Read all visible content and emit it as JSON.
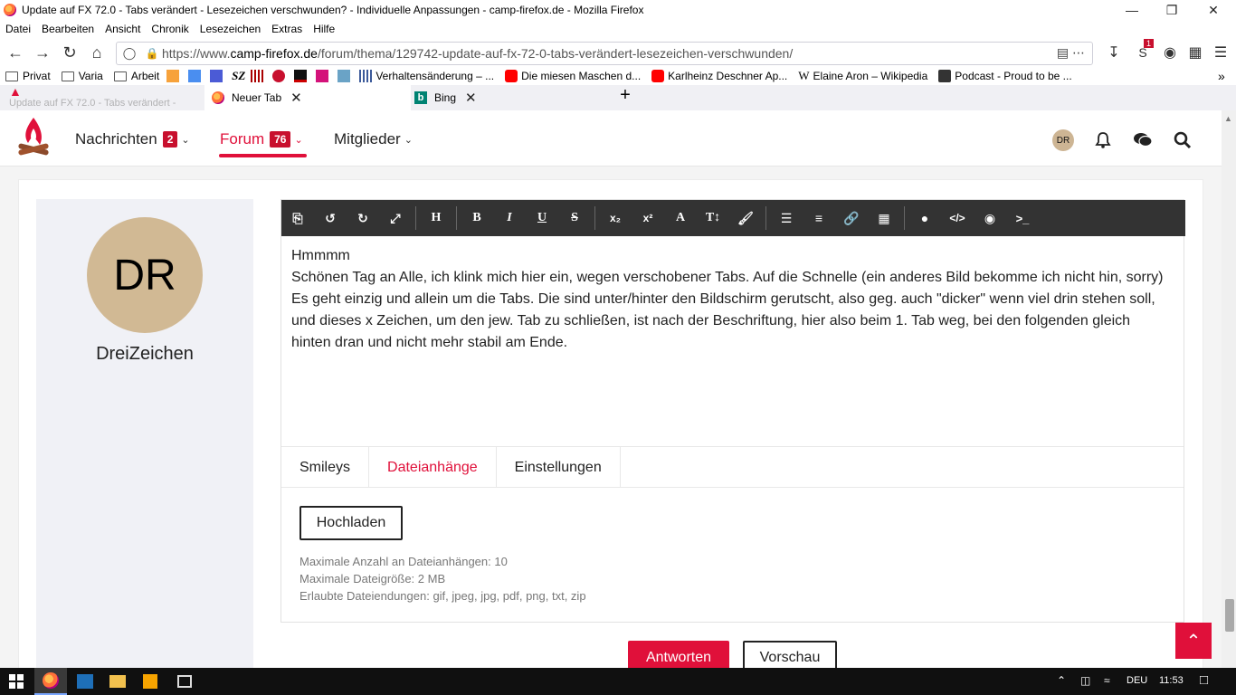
{
  "window": {
    "title": "Update auf FX 72.0 - Tabs verändert - Lesezeichen verschwunden? - Individuelle Anpassungen - camp-firefox.de - Mozilla Firefox"
  },
  "menubar": [
    "Datei",
    "Bearbeiten",
    "Ansicht",
    "Chronik",
    "Lesezeichen",
    "Extras",
    "Hilfe"
  ],
  "urlbar": {
    "prefix": "https://www.",
    "domain": "camp-firefox.de",
    "path": "/forum/thema/129742-update-auf-fx-72-0-tabs-verändert-lesezeichen-verschwunden/"
  },
  "notification_count": "1",
  "bookmarks": {
    "folders": [
      "Privat",
      "Varia",
      "Arbeit"
    ],
    "sz": "SZ",
    "items": [
      "Verhaltensänderung – ...",
      "Die miesen Maschen d...",
      "Karlheinz Deschner Ap...",
      "Elaine Aron – Wikipedia",
      "Podcast - Proud to be ..."
    ],
    "w_glyph": "W"
  },
  "tabs": [
    {
      "label": "Update auf FX 72.0 - Tabs verändert -"
    },
    {
      "label": "Neuer Tab"
    },
    {
      "label": "Bing"
    }
  ],
  "site": {
    "nav": [
      {
        "label": "Nachrichten",
        "badge": "2"
      },
      {
        "label": "Forum",
        "badge": "76"
      },
      {
        "label": "Mitglieder"
      }
    ],
    "header_avatar": "DR"
  },
  "user": {
    "initials": "DR",
    "name": "DreiZeichen"
  },
  "editor": {
    "line1": "Hmmmm",
    "line2": "Schönen Tag an Alle, ich klink mich hier ein, wegen verschobener Tabs. Auf die Schnelle (ein anderes Bild bekomme ich nicht hin, sorry) Es geht einzig und allein um die Tabs. Die sind unter/hinter den Bildschirm gerutscht, also geg. auch \"dicker\" wenn viel drin stehen soll, und dieses x Zeichen, um den jew. Tab zu schließen, ist nach der Beschriftung, hier also beim 1. Tab weg, bei den folgenden gleich hinten dran und nicht mehr stabil am Ende."
  },
  "subtabs": [
    "Smileys",
    "Dateianhänge",
    "Einstellungen"
  ],
  "attachments": {
    "upload_label": "Hochladen",
    "max_count": "Maximale Anzahl an Dateianhängen: 10",
    "max_size": "Maximale Dateigröße: 2 MB",
    "extensions": "Erlaubte Dateiendungen: gif, jpeg, jpg, pdf, png, txt, zip"
  },
  "actions": {
    "reply": "Antworten",
    "preview": "Vorschau"
  },
  "taskbar": {
    "lang": "DEU",
    "time": "11:53"
  },
  "colors": {
    "accent": "#e0103a",
    "toolbar": "#333333",
    "avatar": "#d1b994"
  }
}
